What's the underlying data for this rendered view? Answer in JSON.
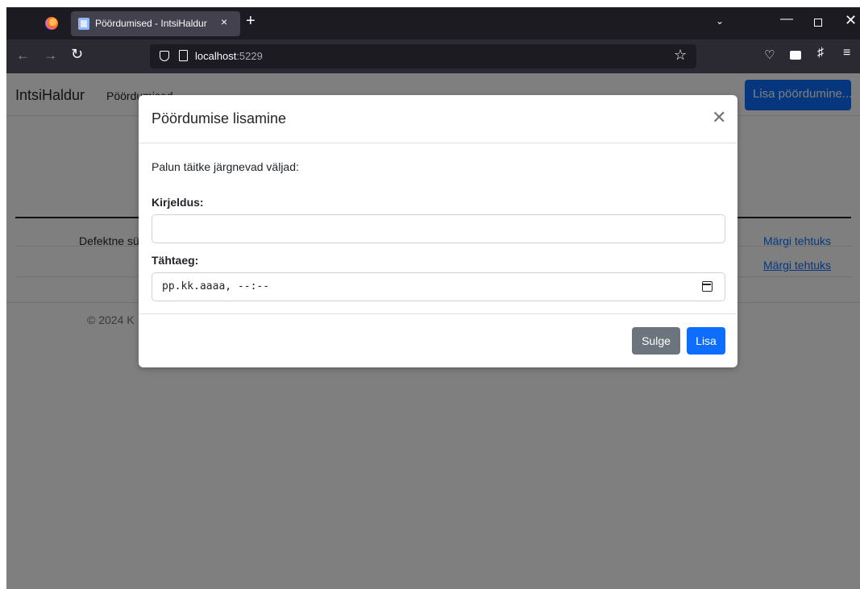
{
  "browser": {
    "tab_title": "Pöördumised - IntsiHaldur",
    "tab_close": "×",
    "new_tab": "+",
    "url_host": "localhost",
    "url_port": ":5229",
    "icons": [
      "firefox-logo-icon",
      "back-arrow-icon",
      "forward-arrow-icon",
      "reload-icon",
      "shield-icon",
      "page-icon",
      "bookmark-star-icon",
      "pocket-icon",
      "reader-icon",
      "extensions-icon",
      "menu-icon"
    ]
  },
  "page": {
    "brand": "IntsiHaldur",
    "nav_link": "Pöördumised",
    "add_button": "Lisa pöördumine...",
    "row1_description": "Defektne sü",
    "row1_action": "Märgi tehtuks",
    "row2_action": "Märgi tehtuks",
    "footer": "© 2024 K"
  },
  "modal": {
    "title": "Pöördumise lisamine",
    "intro": "Palun täitke järgnevad väljad:",
    "description_label": "Kirjeldus:",
    "description_value": "",
    "due_label": "Tähtaeg:",
    "due_placeholder": "pp.kk.aaaa, --:--",
    "close_button": "Sulge",
    "submit_button": "Lisa"
  },
  "colors": {
    "primary": "#0d6efd",
    "secondary": "#6c757d",
    "backdrop": "rgba(0,0,0,0.5)"
  }
}
